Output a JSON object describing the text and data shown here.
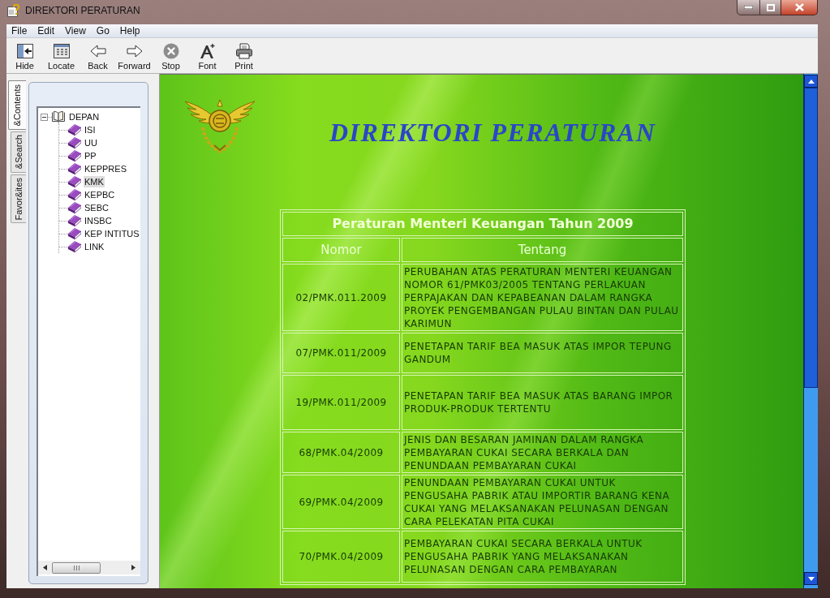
{
  "window": {
    "title": "DIREKTORI PERATURAN"
  },
  "menu": [
    "File",
    "Edit",
    "View",
    "Go",
    "Help"
  ],
  "toolbar": [
    "Hide",
    "Locate",
    "Back",
    "Forward",
    "Stop",
    "Font",
    "Print"
  ],
  "nav_tabs": [
    {
      "label": "&Contents",
      "selected": true
    },
    {
      "label": "&Search",
      "selected": false
    },
    {
      "label": "Favor&ites",
      "selected": false
    }
  ],
  "tree": {
    "label": "DEPAN",
    "expanded": true,
    "selected": false,
    "children": [
      {
        "label": "ISI",
        "selected": false
      },
      {
        "label": "UU",
        "selected": false
      },
      {
        "label": "PP",
        "selected": false
      },
      {
        "label": "KEPPRES",
        "selected": false
      },
      {
        "label": "KMK",
        "selected": true
      },
      {
        "label": "KEPBC",
        "selected": false
      },
      {
        "label": "SEBC",
        "selected": false
      },
      {
        "label": "INSBC",
        "selected": false
      },
      {
        "label": "KEP INTITUS",
        "selected": false
      },
      {
        "label": "LINK",
        "selected": false
      }
    ]
  },
  "page": {
    "heading": "DIREKTORI PERATURAN",
    "table": {
      "caption": "Peraturan Menteri Keuangan Tahun 2009",
      "columns": [
        "Nomor",
        "Tentang"
      ],
      "rows": [
        {
          "nomor": "02/PMK.011.2009",
          "tentang": "PERUBAHAN ATAS PERATURAN MENTERI KEUANGAN NOMOR 61/PMK03/2005 TENTANG PERLAKUAN PERPAJAKAN DAN KEPABEANAN DALAM RANGKA PROYEK PENGEMBANGAN PULAU BINTAN DAN PULAU KARIMUN"
        },
        {
          "nomor": "07/PMK.011/2009",
          "tentang": "PENETAPAN TARIF BEA MASUK ATAS IMPOR TEPUNG GANDUM"
        },
        {
          "nomor": "19/PMK.011/2009",
          "tentang": "PENETAPAN TARIF BEA MASUK ATAS BARANG IMPOR PRODUK-PRODUK TERTENTU"
        },
        {
          "nomor": "68/PMK.04/2009",
          "tentang": "JENIS DAN BESARAN JAMINAN DALAM RANGKA PEMBAYARAN CUKAI SECARA BERKALA DAN PENUNDAAN PEMBAYARAN CUKAI"
        },
        {
          "nomor": "69/PMK.04/2009",
          "tentang": "PENUNDAAN PEMBAYARAN CUKAI UNTUK PENGUSAHA PABRIK ATAU IMPORTIR BARANG KENA CUKAI YANG MELAKSANAKAN PELUNASAN DENGAN CARA PELEKATAN PITA CUKAI"
        },
        {
          "nomor": "70/PMK.04/2009",
          "tentang": "PEMBAYARAN CUKAI SECARA BERKALA UNTUK PENGUSAHA PABRIK YANG MELAKSANAKAN PELUNASAN DENGAN CARA PEMBAYARAN"
        }
      ]
    }
  }
}
